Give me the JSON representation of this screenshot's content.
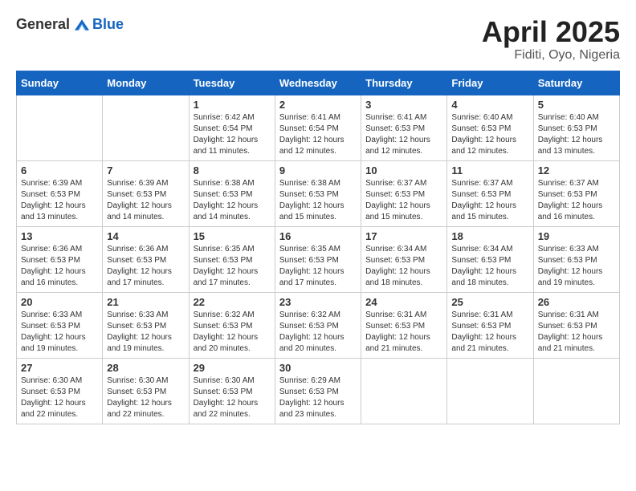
{
  "logo": {
    "general": "General",
    "blue": "Blue"
  },
  "title": {
    "month_year": "April 2025",
    "location": "Fiditi, Oyo, Nigeria"
  },
  "weekdays": [
    "Sunday",
    "Monday",
    "Tuesday",
    "Wednesday",
    "Thursday",
    "Friday",
    "Saturday"
  ],
  "weeks": [
    [
      {
        "day": "",
        "sunrise": "",
        "sunset": "",
        "daylight": ""
      },
      {
        "day": "",
        "sunrise": "",
        "sunset": "",
        "daylight": ""
      },
      {
        "day": "1",
        "sunrise": "Sunrise: 6:42 AM",
        "sunset": "Sunset: 6:54 PM",
        "daylight": "Daylight: 12 hours and 11 minutes."
      },
      {
        "day": "2",
        "sunrise": "Sunrise: 6:41 AM",
        "sunset": "Sunset: 6:54 PM",
        "daylight": "Daylight: 12 hours and 12 minutes."
      },
      {
        "day": "3",
        "sunrise": "Sunrise: 6:41 AM",
        "sunset": "Sunset: 6:53 PM",
        "daylight": "Daylight: 12 hours and 12 minutes."
      },
      {
        "day": "4",
        "sunrise": "Sunrise: 6:40 AM",
        "sunset": "Sunset: 6:53 PM",
        "daylight": "Daylight: 12 hours and 12 minutes."
      },
      {
        "day": "5",
        "sunrise": "Sunrise: 6:40 AM",
        "sunset": "Sunset: 6:53 PM",
        "daylight": "Daylight: 12 hours and 13 minutes."
      }
    ],
    [
      {
        "day": "6",
        "sunrise": "Sunrise: 6:39 AM",
        "sunset": "Sunset: 6:53 PM",
        "daylight": "Daylight: 12 hours and 13 minutes."
      },
      {
        "day": "7",
        "sunrise": "Sunrise: 6:39 AM",
        "sunset": "Sunset: 6:53 PM",
        "daylight": "Daylight: 12 hours and 14 minutes."
      },
      {
        "day": "8",
        "sunrise": "Sunrise: 6:38 AM",
        "sunset": "Sunset: 6:53 PM",
        "daylight": "Daylight: 12 hours and 14 minutes."
      },
      {
        "day": "9",
        "sunrise": "Sunrise: 6:38 AM",
        "sunset": "Sunset: 6:53 PM",
        "daylight": "Daylight: 12 hours and 15 minutes."
      },
      {
        "day": "10",
        "sunrise": "Sunrise: 6:37 AM",
        "sunset": "Sunset: 6:53 PM",
        "daylight": "Daylight: 12 hours and 15 minutes."
      },
      {
        "day": "11",
        "sunrise": "Sunrise: 6:37 AM",
        "sunset": "Sunset: 6:53 PM",
        "daylight": "Daylight: 12 hours and 15 minutes."
      },
      {
        "day": "12",
        "sunrise": "Sunrise: 6:37 AM",
        "sunset": "Sunset: 6:53 PM",
        "daylight": "Daylight: 12 hours and 16 minutes."
      }
    ],
    [
      {
        "day": "13",
        "sunrise": "Sunrise: 6:36 AM",
        "sunset": "Sunset: 6:53 PM",
        "daylight": "Daylight: 12 hours and 16 minutes."
      },
      {
        "day": "14",
        "sunrise": "Sunrise: 6:36 AM",
        "sunset": "Sunset: 6:53 PM",
        "daylight": "Daylight: 12 hours and 17 minutes."
      },
      {
        "day": "15",
        "sunrise": "Sunrise: 6:35 AM",
        "sunset": "Sunset: 6:53 PM",
        "daylight": "Daylight: 12 hours and 17 minutes."
      },
      {
        "day": "16",
        "sunrise": "Sunrise: 6:35 AM",
        "sunset": "Sunset: 6:53 PM",
        "daylight": "Daylight: 12 hours and 17 minutes."
      },
      {
        "day": "17",
        "sunrise": "Sunrise: 6:34 AM",
        "sunset": "Sunset: 6:53 PM",
        "daylight": "Daylight: 12 hours and 18 minutes."
      },
      {
        "day": "18",
        "sunrise": "Sunrise: 6:34 AM",
        "sunset": "Sunset: 6:53 PM",
        "daylight": "Daylight: 12 hours and 18 minutes."
      },
      {
        "day": "19",
        "sunrise": "Sunrise: 6:33 AM",
        "sunset": "Sunset: 6:53 PM",
        "daylight": "Daylight: 12 hours and 19 minutes."
      }
    ],
    [
      {
        "day": "20",
        "sunrise": "Sunrise: 6:33 AM",
        "sunset": "Sunset: 6:53 PM",
        "daylight": "Daylight: 12 hours and 19 minutes."
      },
      {
        "day": "21",
        "sunrise": "Sunrise: 6:33 AM",
        "sunset": "Sunset: 6:53 PM",
        "daylight": "Daylight: 12 hours and 19 minutes."
      },
      {
        "day": "22",
        "sunrise": "Sunrise: 6:32 AM",
        "sunset": "Sunset: 6:53 PM",
        "daylight": "Daylight: 12 hours and 20 minutes."
      },
      {
        "day": "23",
        "sunrise": "Sunrise: 6:32 AM",
        "sunset": "Sunset: 6:53 PM",
        "daylight": "Daylight: 12 hours and 20 minutes."
      },
      {
        "day": "24",
        "sunrise": "Sunrise: 6:31 AM",
        "sunset": "Sunset: 6:53 PM",
        "daylight": "Daylight: 12 hours and 21 minutes."
      },
      {
        "day": "25",
        "sunrise": "Sunrise: 6:31 AM",
        "sunset": "Sunset: 6:53 PM",
        "daylight": "Daylight: 12 hours and 21 minutes."
      },
      {
        "day": "26",
        "sunrise": "Sunrise: 6:31 AM",
        "sunset": "Sunset: 6:53 PM",
        "daylight": "Daylight: 12 hours and 21 minutes."
      }
    ],
    [
      {
        "day": "27",
        "sunrise": "Sunrise: 6:30 AM",
        "sunset": "Sunset: 6:53 PM",
        "daylight": "Daylight: 12 hours and 22 minutes."
      },
      {
        "day": "28",
        "sunrise": "Sunrise: 6:30 AM",
        "sunset": "Sunset: 6:53 PM",
        "daylight": "Daylight: 12 hours and 22 minutes."
      },
      {
        "day": "29",
        "sunrise": "Sunrise: 6:30 AM",
        "sunset": "Sunset: 6:53 PM",
        "daylight": "Daylight: 12 hours and 22 minutes."
      },
      {
        "day": "30",
        "sunrise": "Sunrise: 6:29 AM",
        "sunset": "Sunset: 6:53 PM",
        "daylight": "Daylight: 12 hours and 23 minutes."
      },
      {
        "day": "",
        "sunrise": "",
        "sunset": "",
        "daylight": ""
      },
      {
        "day": "",
        "sunrise": "",
        "sunset": "",
        "daylight": ""
      },
      {
        "day": "",
        "sunrise": "",
        "sunset": "",
        "daylight": ""
      }
    ]
  ]
}
